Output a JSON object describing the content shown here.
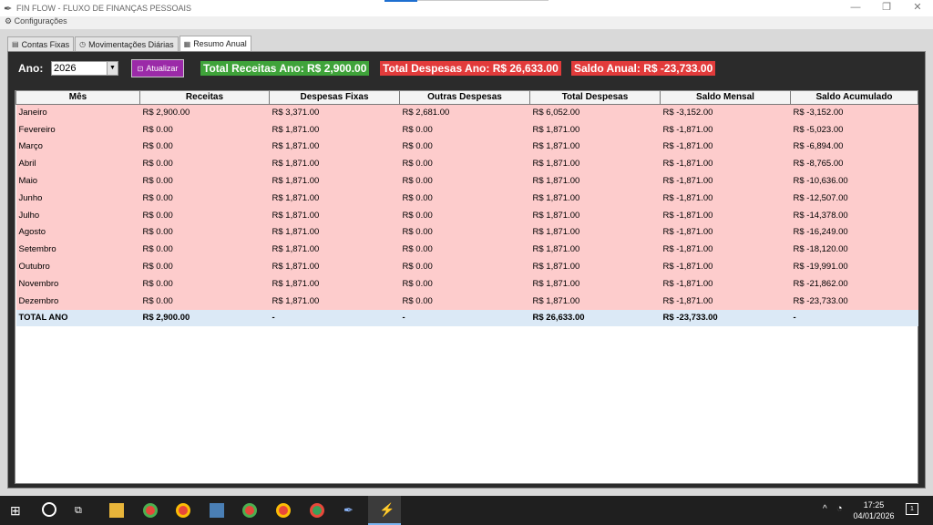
{
  "window": {
    "title": "FIN FLOW - FLUXO DE FINANÇAS PESSOAIS",
    "controls": {
      "minimize": "—",
      "maximize": "❐",
      "close": "✕"
    }
  },
  "menu": {
    "settings": "Configurações"
  },
  "tabs": [
    {
      "label": "Contas Fixas",
      "icon": "document-icon"
    },
    {
      "label": "Movimentações Diárias",
      "icon": "clock-icon"
    },
    {
      "label": "Resumo Anual",
      "icon": "calendar-icon",
      "active": true
    }
  ],
  "toolbar": {
    "year_label": "Ano:",
    "year_value": "2026",
    "refresh_label": "Atualizar"
  },
  "summary": {
    "total_receitas": "Total Receitas Ano: R$ 2,900.00",
    "total_despesas": "Total Despesas Ano: R$ 26,633.00",
    "saldo_anual": "Saldo Anual: R$ -23,733.00"
  },
  "table": {
    "headers": [
      "Mês",
      "Receitas",
      "Despesas Fixas",
      "Outras Despesas",
      "Total Despesas",
      "Saldo Mensal",
      "Saldo Acumulado"
    ],
    "rows": [
      [
        "Janeiro",
        "R$ 2,900.00",
        "R$ 3,371.00",
        "R$ 2,681.00",
        "R$ 6,052.00",
        "R$ -3,152.00",
        "R$ -3,152.00"
      ],
      [
        "Fevereiro",
        "R$ 0.00",
        "R$ 1,871.00",
        "R$ 0.00",
        "R$ 1,871.00",
        "R$ -1,871.00",
        "R$ -5,023.00"
      ],
      [
        "Março",
        "R$ 0.00",
        "R$ 1,871.00",
        "R$ 0.00",
        "R$ 1,871.00",
        "R$ -1,871.00",
        "R$ -6,894.00"
      ],
      [
        "Abril",
        "R$ 0.00",
        "R$ 1,871.00",
        "R$ 0.00",
        "R$ 1,871.00",
        "R$ -1,871.00",
        "R$ -8,765.00"
      ],
      [
        "Maio",
        "R$ 0.00",
        "R$ 1,871.00",
        "R$ 0.00",
        "R$ 1,871.00",
        "R$ -1,871.00",
        "R$ -10,636.00"
      ],
      [
        "Junho",
        "R$ 0.00",
        "R$ 1,871.00",
        "R$ 0.00",
        "R$ 1,871.00",
        "R$ -1,871.00",
        "R$ -12,507.00"
      ],
      [
        "Julho",
        "R$ 0.00",
        "R$ 1,871.00",
        "R$ 0.00",
        "R$ 1,871.00",
        "R$ -1,871.00",
        "R$ -14,378.00"
      ],
      [
        "Agosto",
        "R$ 0.00",
        "R$ 1,871.00",
        "R$ 0.00",
        "R$ 1,871.00",
        "R$ -1,871.00",
        "R$ -16,249.00"
      ],
      [
        "Setembro",
        "R$ 0.00",
        "R$ 1,871.00",
        "R$ 0.00",
        "R$ 1,871.00",
        "R$ -1,871.00",
        "R$ -18,120.00"
      ],
      [
        "Outubro",
        "R$ 0.00",
        "R$ 1,871.00",
        "R$ 0.00",
        "R$ 1,871.00",
        "R$ -1,871.00",
        "R$ -19,991.00"
      ],
      [
        "Novembro",
        "R$ 0.00",
        "R$ 1,871.00",
        "R$ 0.00",
        "R$ 1,871.00",
        "R$ -1,871.00",
        "R$ -21,862.00"
      ],
      [
        "Dezembro",
        "R$ 0.00",
        "R$ 1,871.00",
        "R$ 0.00",
        "R$ 1,871.00",
        "R$ -1,871.00",
        "R$ -23,733.00"
      ]
    ],
    "total_row": [
      "TOTAL ANO",
      "R$ 2,900.00",
      "-",
      "-",
      "R$ 26,633.00",
      "R$ -23,733.00",
      "-"
    ]
  },
  "taskbar": {
    "time": "17:25",
    "date": "04/01/2026",
    "notification_count": "1"
  },
  "colors": {
    "accent_purple": "#9b2aa8",
    "positive_green": "#3fa33a",
    "negative_red": "#e23b3b",
    "row_pink": "#fdcccc",
    "total_blue": "#dbe9f6"
  }
}
